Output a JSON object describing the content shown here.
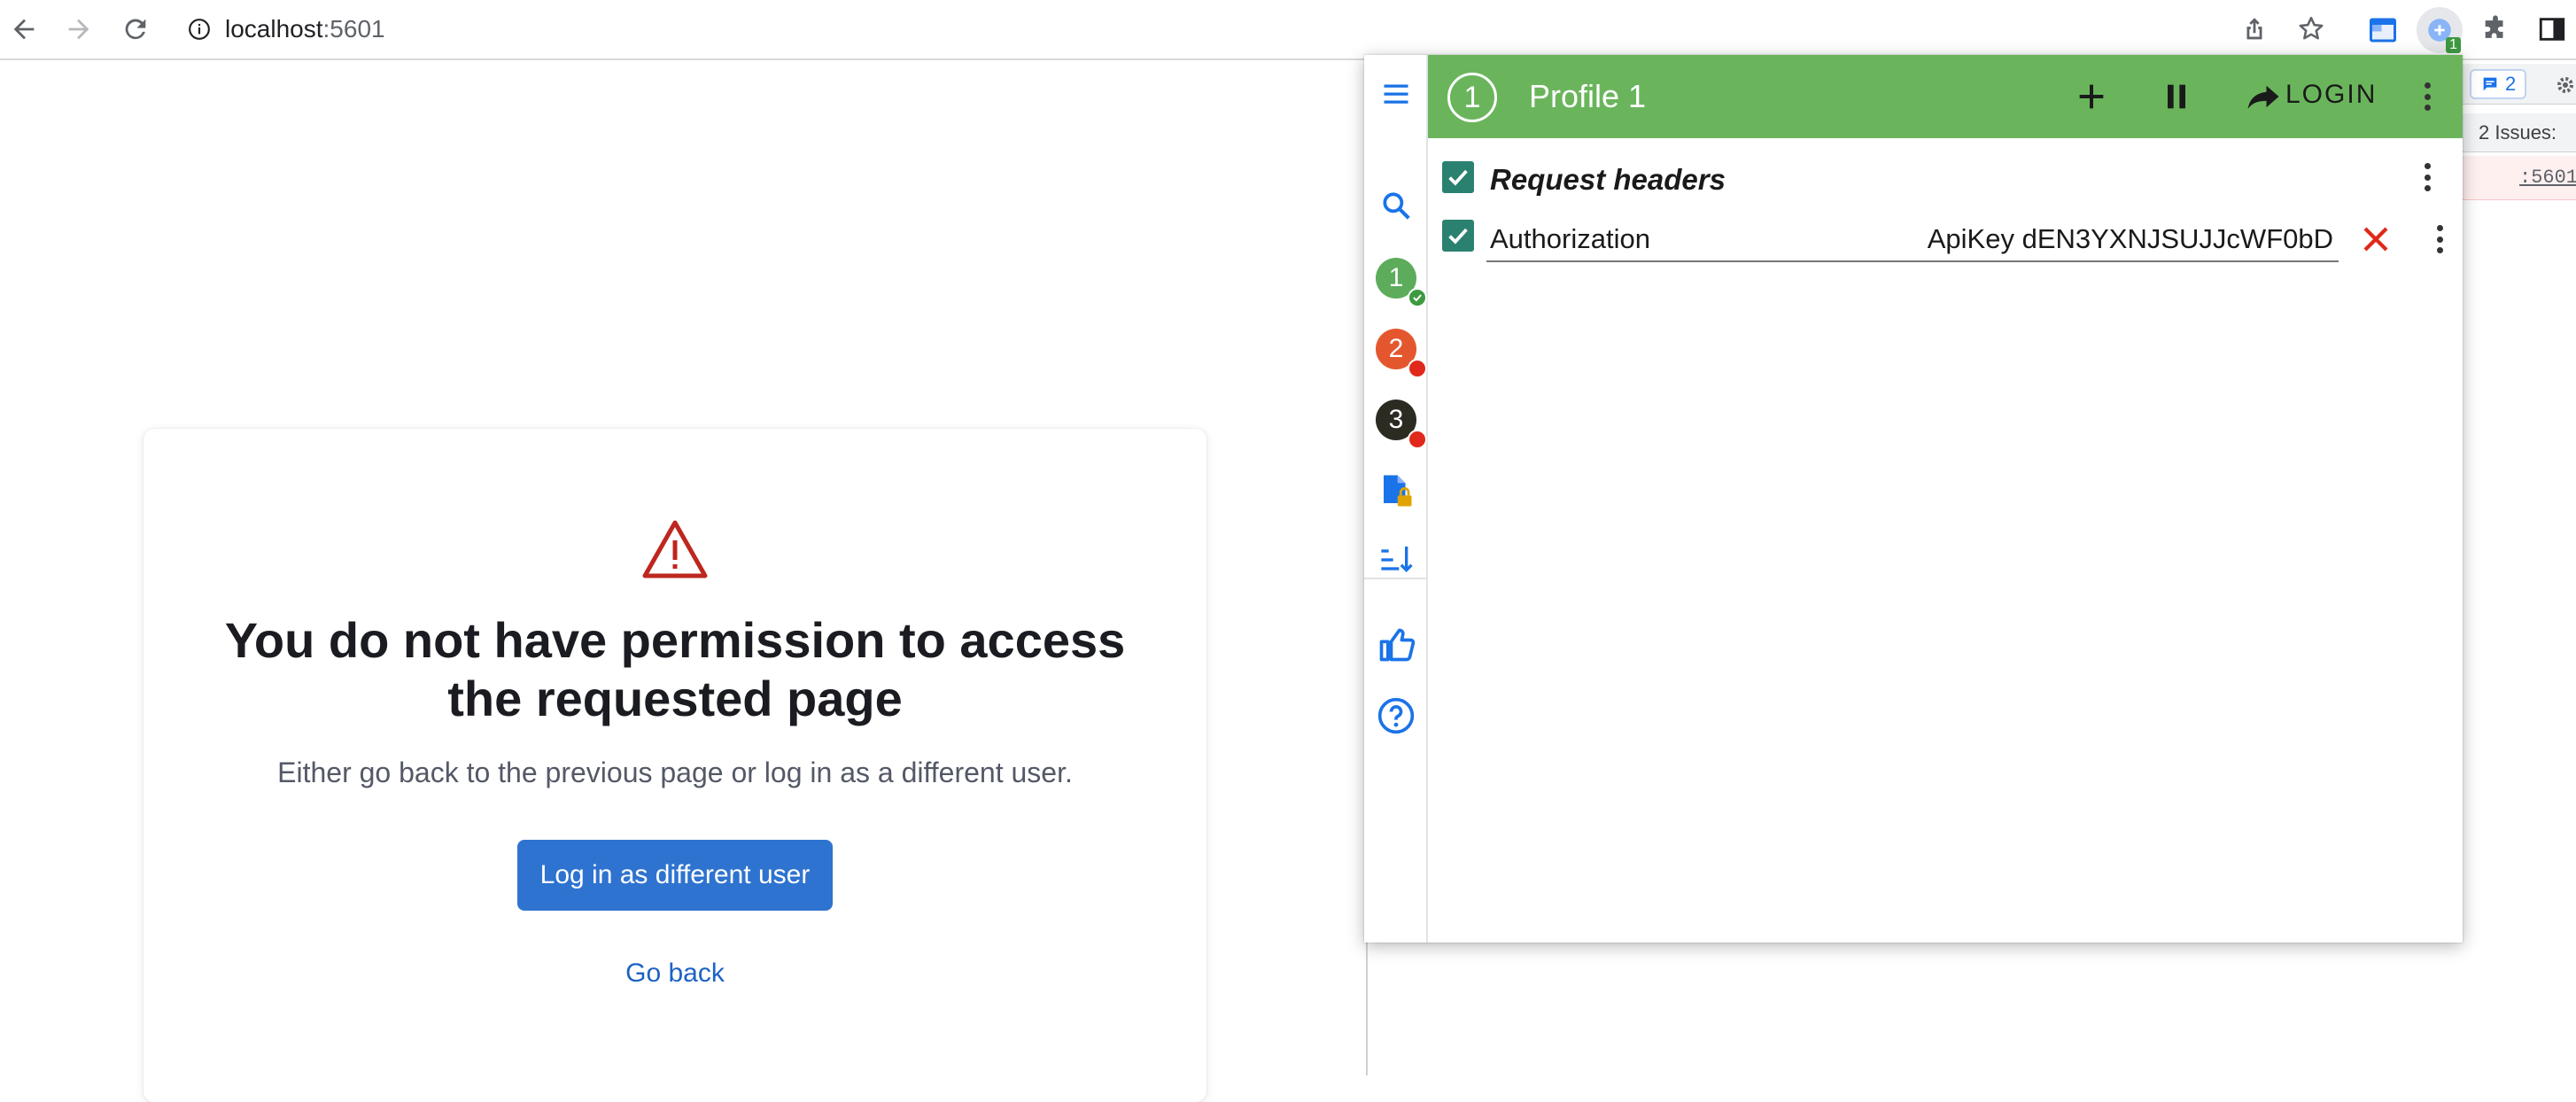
{
  "browser": {
    "url_host": "localhost",
    "url_port": ":5601",
    "extension_badge": "1"
  },
  "devtools": {
    "issues_badge_count": "2",
    "issues_label": "2 Issues:",
    "error_link": ":5601"
  },
  "page": {
    "title": "You do not have permission to access the requested page",
    "subtitle": "Either go back to the previous page or log in as a different user.",
    "login_button": "Log in as different user",
    "back_link": "Go back"
  },
  "popup": {
    "profile_number": "1",
    "profile_title": "Profile 1",
    "login_label": "LOGIN",
    "section_title": "Request headers",
    "rail_profiles": [
      {
        "label": "1",
        "color": "#5cac5c",
        "status": "ok"
      },
      {
        "label": "2",
        "color": "#e4572e",
        "status": "error"
      },
      {
        "label": "3",
        "color": "#2b2b22",
        "status": "error"
      }
    ],
    "headers": [
      {
        "name": "Authorization",
        "value": "ApiKey dEN3YXNJSUJJcWF0bD",
        "enabled": true
      }
    ]
  },
  "colors": {
    "accent_green": "#6ab55c",
    "checkbox_teal": "#2b8170",
    "primary_button": "#2e73cf",
    "link_blue": "#1d62c4",
    "warning_red": "#bd271e",
    "rail_icon_blue": "#1a73e8"
  }
}
